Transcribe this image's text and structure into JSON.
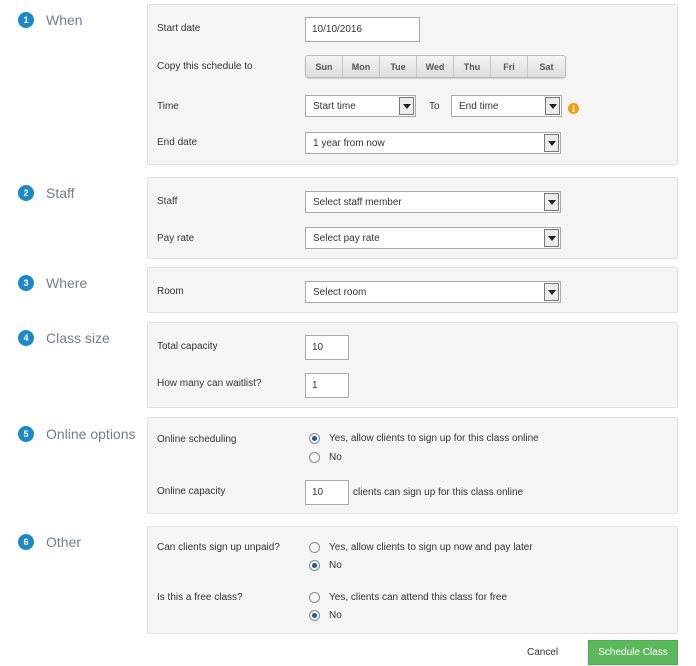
{
  "sections": {
    "when": {
      "num": "1",
      "title": "When"
    },
    "staff": {
      "num": "2",
      "title": "Staff"
    },
    "where": {
      "num": "3",
      "title": "Where"
    },
    "class_size": {
      "num": "4",
      "title": "Class size"
    },
    "online": {
      "num": "5",
      "title": "Online options"
    },
    "other": {
      "num": "6",
      "title": "Other"
    }
  },
  "when": {
    "start_date_label": "Start date",
    "start_date_value": "10/10/2016",
    "copy_label": "Copy this schedule to",
    "days": [
      "Sun",
      "Mon",
      "Tue",
      "Wed",
      "Thu",
      "Fri",
      "Sat"
    ],
    "time_label": "Time",
    "start_time": "Start time",
    "to_label": "To",
    "end_time": "End time",
    "info_icon": "info-icon",
    "end_date_label": "End date",
    "end_date_value": "1 year from now"
  },
  "staff": {
    "staff_label": "Staff",
    "staff_value": "Select staff member",
    "pay_label": "Pay rate",
    "pay_value": "Select pay rate"
  },
  "where": {
    "room_label": "Room",
    "room_value": "Select room"
  },
  "class_size": {
    "total_label": "Total capacity",
    "total_value": "10",
    "waitlist_label": "How many can waitlist?",
    "waitlist_value": "1"
  },
  "online": {
    "scheduling_label": "Online scheduling",
    "yes_label": "Yes, allow clients to sign up for this class online",
    "no_label": "No",
    "selected": "yes",
    "capacity_label": "Online capacity",
    "capacity_value": "10",
    "capacity_suffix": "clients can sign up for this class online"
  },
  "other": {
    "unpaid_label": "Can clients sign up unpaid?",
    "unpaid_yes": "Yes, allow clients to sign up now and pay later",
    "unpaid_no": "No",
    "unpaid_selected": "no",
    "free_label": "Is this a free class?",
    "free_yes": "Yes, clients can attend this class for free",
    "free_no": "No",
    "free_selected": "no"
  },
  "actions": {
    "cancel": "Cancel",
    "schedule": "Schedule Class"
  },
  "colors": {
    "accent": "#1e88c7",
    "primary_button": "#5cb85c",
    "info": "#f39c12"
  }
}
